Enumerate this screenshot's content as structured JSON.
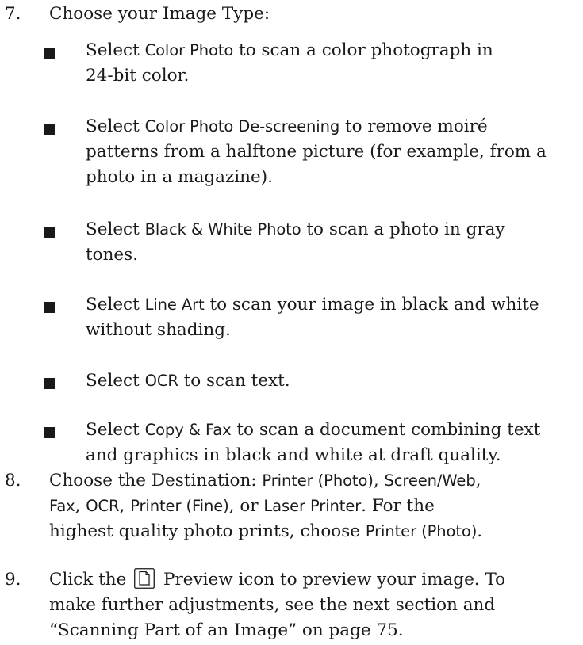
{
  "step7": {
    "number": "7.",
    "text": "Choose your Image Type:",
    "bullets": [
      {
        "pre": "Select ",
        "ui": "Color Photo",
        "post": " to scan a color photograph in",
        "line2": "24-bit color."
      },
      {
        "pre": "Select ",
        "ui": "Color Photo De-screening",
        "post": " to remove moiré",
        "line2": "patterns from a halftone picture (for example, from a",
        "line3": "photo in a magazine)."
      },
      {
        "pre": "Select ",
        "ui": "Black & White Photo",
        "post": " to scan a photo in gray",
        "line2": "tones."
      },
      {
        "pre": "Select ",
        "ui": "Line Art",
        "post": " to scan your image in black and white",
        "line2": "without shading."
      },
      {
        "pre": "Select ",
        "ui": "OCR",
        "post": " to scan text."
      },
      {
        "pre": "Select ",
        "ui": "Copy & Fax",
        "post": " to scan a document combining text",
        "line2": "and graphics in black and white at draft quality."
      }
    ]
  },
  "step8": {
    "number": "8.",
    "l1_pre": "Choose the Destination: ",
    "opt1": "Printer (Photo)",
    "sep1": ", ",
    "opt2": "Screen/Web",
    "sep2": ",",
    "opt3": "Fax",
    "sep3": ", ",
    "opt4": "OCR",
    "sep4": ", ",
    "opt5": "Printer (Fine)",
    "sep5": ", or ",
    "opt6": "Laser Printer",
    "l2_post": ". For the",
    "l3_pre": "highest quality photo prints, choose ",
    "opt7": "Printer (Photo)",
    "end": "."
  },
  "step9": {
    "number": "9.",
    "pre": "Click the",
    "icon": "preview-document-icon",
    "post": "Preview icon to preview your image. To",
    "line2": "make further adjustments, see the next section and",
    "line3": "“Scanning Part of an Image” on page 75."
  },
  "colors": {
    "text": "#1a1a1a"
  }
}
